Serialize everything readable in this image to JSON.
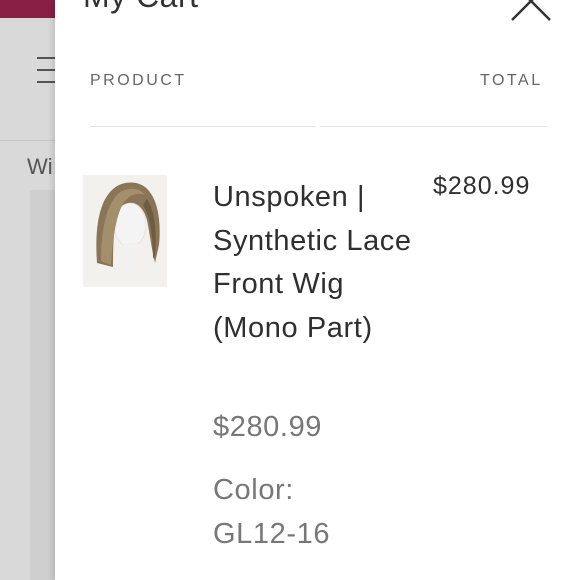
{
  "background": {
    "partial_text": "Wi"
  },
  "cart": {
    "title": "My Cart",
    "close_icon": "close-icon",
    "columns": {
      "product": "PRODUCT",
      "total": "TOTAL"
    },
    "items": [
      {
        "name": "Unspoken | Synthetic Lace Front Wig (Mono Part)",
        "price": "$280.99",
        "total": "$280.99",
        "color_label": "Color:",
        "color_value": "GL12-16"
      }
    ]
  }
}
